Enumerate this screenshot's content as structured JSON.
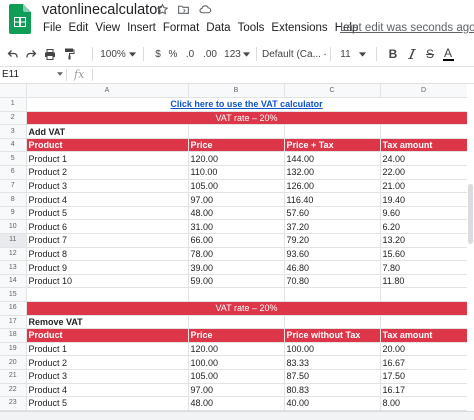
{
  "doc": {
    "title": "vatonlinecalculator",
    "last_edit": "Last edit was seconds ago"
  },
  "menu": [
    "File",
    "Edit",
    "View",
    "Insert",
    "Format",
    "Data",
    "Tools",
    "Extensions",
    "Help"
  ],
  "toolbar": {
    "zoom": "100%",
    "currency": "$",
    "percent": "%",
    "decrease_decimal": ".0",
    "increase_decimal": ".00",
    "number_format": "123",
    "font": "Default (Ca...",
    "font_size": "11",
    "bold": "B",
    "strikethrough": "S",
    "text_color": "A"
  },
  "formula_bar": {
    "cell_ref": "E11",
    "fx": "fx",
    "content": ""
  },
  "columns": [
    "A",
    "B",
    "C",
    "D"
  ],
  "sheet": {
    "r1": {
      "num": "1",
      "link": "Click here to use the VAT calculator"
    },
    "r2": {
      "num": "2",
      "banner": "VAT rate –  20%"
    },
    "r3": {
      "num": "3",
      "label": "Add VAT"
    },
    "r4": {
      "num": "4",
      "h": [
        "Product",
        "Price",
        "Price + Tax",
        "Tax amount"
      ]
    },
    "add_rows": [
      {
        "num": "5",
        "c": [
          "Product 1",
          "120.00",
          "144.00",
          "24.00"
        ]
      },
      {
        "num": "6",
        "c": [
          "Product 2",
          "110.00",
          "132.00",
          "22.00"
        ]
      },
      {
        "num": "7",
        "c": [
          "Product 3",
          "105.00",
          "126.00",
          "21.00"
        ]
      },
      {
        "num": "8",
        "c": [
          "Product 4",
          "97.00",
          "116.40",
          "19.40"
        ]
      },
      {
        "num": "9",
        "c": [
          "Product 5",
          "48.00",
          "57.60",
          "9.60"
        ]
      },
      {
        "num": "10",
        "c": [
          "Product 6",
          "31.00",
          "37.20",
          "6.20"
        ]
      },
      {
        "num": "11",
        "c": [
          "Product 7",
          "66.00",
          "79.20",
          "13.20"
        ]
      },
      {
        "num": "12",
        "c": [
          "Product 8",
          "78.00",
          "93.60",
          "15.60"
        ]
      },
      {
        "num": "13",
        "c": [
          "Product 9",
          "39.00",
          "46.80",
          "7.80"
        ]
      },
      {
        "num": "14",
        "c": [
          "Product 10",
          "59.00",
          "70.80",
          "11.80"
        ]
      }
    ],
    "r15": {
      "num": "15"
    },
    "r16": {
      "num": "16",
      "banner": "VAT rate –  20%"
    },
    "r17": {
      "num": "17",
      "label": "Remove VAT"
    },
    "r18": {
      "num": "18",
      "h": [
        "Product",
        "Price",
        "Price without Tax",
        "Tax amount"
      ]
    },
    "remove_rows": [
      {
        "num": "19",
        "c": [
          "Product 1",
          "120.00",
          "100.00",
          "20.00"
        ]
      },
      {
        "num": "20",
        "c": [
          "Product 2",
          "100.00",
          "83.33",
          "16.67"
        ]
      },
      {
        "num": "21",
        "c": [
          "Product 3",
          "105.00",
          "87.50",
          "17.50"
        ]
      },
      {
        "num": "22",
        "c": [
          "Product 4",
          "97.00",
          "80.83",
          "16.17"
        ]
      },
      {
        "num": "23",
        "c": [
          "Product 5",
          "48.00",
          "40.00",
          "8.00"
        ]
      }
    ]
  },
  "colors": {
    "accent_red": "#dc3648",
    "link": "#1155cc",
    "selection": "#1a73e8"
  }
}
